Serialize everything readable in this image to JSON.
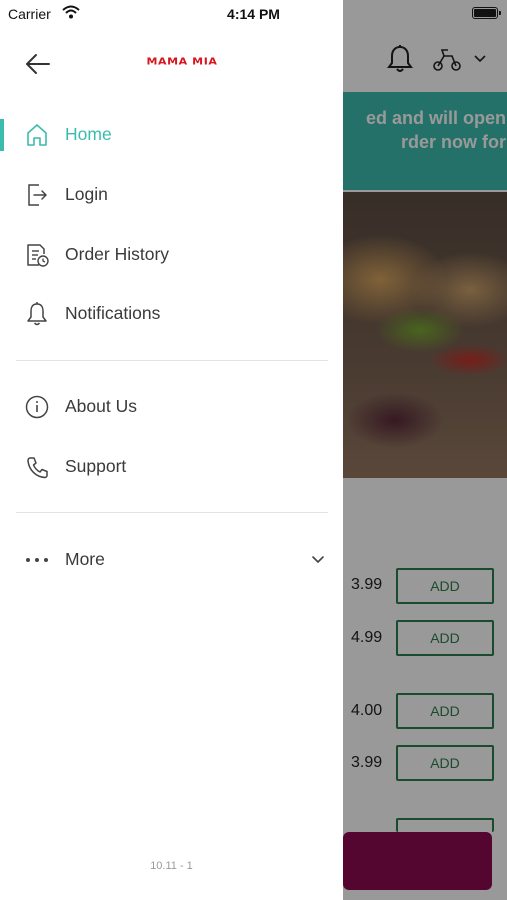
{
  "status_bar": {
    "carrier": "Carrier",
    "time": "4:14 PM"
  },
  "drawer": {
    "logo_text": "MAMA MIA",
    "menu": [
      {
        "label": "Home",
        "icon": "home-icon",
        "active": true
      },
      {
        "label": "Login",
        "icon": "login-icon",
        "active": false
      },
      {
        "label": "Order History",
        "icon": "order-history-icon",
        "active": false
      },
      {
        "label": "Notifications",
        "icon": "bell-icon",
        "active": false
      }
    ],
    "secondary": [
      {
        "label": "About Us",
        "icon": "info-icon"
      },
      {
        "label": "Support",
        "icon": "phone-icon"
      }
    ],
    "more": {
      "label": "More",
      "icon": "more-dots-icon"
    },
    "version": "10.11 - 1"
  },
  "background": {
    "banner_lines": [
      "ed and will open",
      "rder now for"
    ],
    "items": [
      {
        "price": "3.99",
        "button": "ADD"
      },
      {
        "price": "4.99",
        "button": "ADD"
      },
      {
        "price": "4.00",
        "button": "ADD"
      },
      {
        "price": "3.99",
        "button": "ADD"
      }
    ]
  },
  "colors": {
    "accent": "#3bbcae",
    "brand_red": "#d8141c",
    "cta": "#8c0a52",
    "add_green": "#2e7d4f"
  }
}
